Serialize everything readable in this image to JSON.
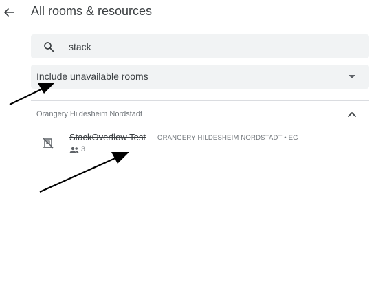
{
  "header": {
    "title": "All rooms & resources"
  },
  "search": {
    "value": "stack"
  },
  "filter": {
    "selected_label": "Include unavailable rooms"
  },
  "group": {
    "title": "Orangery Hildesheim Nordstadt",
    "rooms": [
      {
        "name": "StackOverflow Test",
        "location": "ORANGERY HILDESHEIM NORDSTADT • EG",
        "capacity": "3",
        "available": false
      }
    ]
  },
  "icons": {
    "back": "arrow-back-icon",
    "search": "search-icon",
    "dropdown": "dropdown-arrow-icon",
    "collapse": "chevron-up-icon",
    "room_unavailable": "room-unavailable-icon",
    "capacity": "people-icon"
  },
  "colors": {
    "field_background": "#f1f3f4",
    "primary_text": "#3c4043",
    "secondary_text": "#70757a",
    "divider": "#dadce0"
  }
}
